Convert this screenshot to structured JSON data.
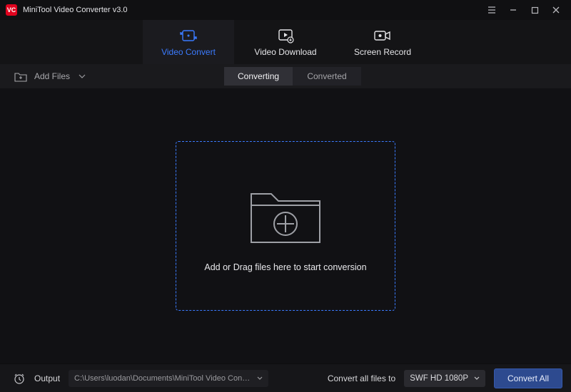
{
  "app": {
    "title": "MiniTool Video Converter v3.0",
    "logo_text": "VC"
  },
  "modes": {
    "video_convert": "Video Convert",
    "video_download": "Video Download",
    "screen_record": "Screen Record"
  },
  "toolbar": {
    "add_files": "Add Files"
  },
  "tabs": {
    "converting": "Converting",
    "converted": "Converted"
  },
  "dropzone": {
    "message": "Add or Drag files here to start conversion"
  },
  "footer": {
    "output_label": "Output",
    "output_path": "C:\\Users\\luodan\\Documents\\MiniTool Video Converter\\output",
    "convert_to_label": "Convert all files to",
    "format": "SWF HD 1080P",
    "convert_all": "Convert All"
  },
  "colors": {
    "accent": "#3b7bff",
    "brand": "#e0031e"
  }
}
